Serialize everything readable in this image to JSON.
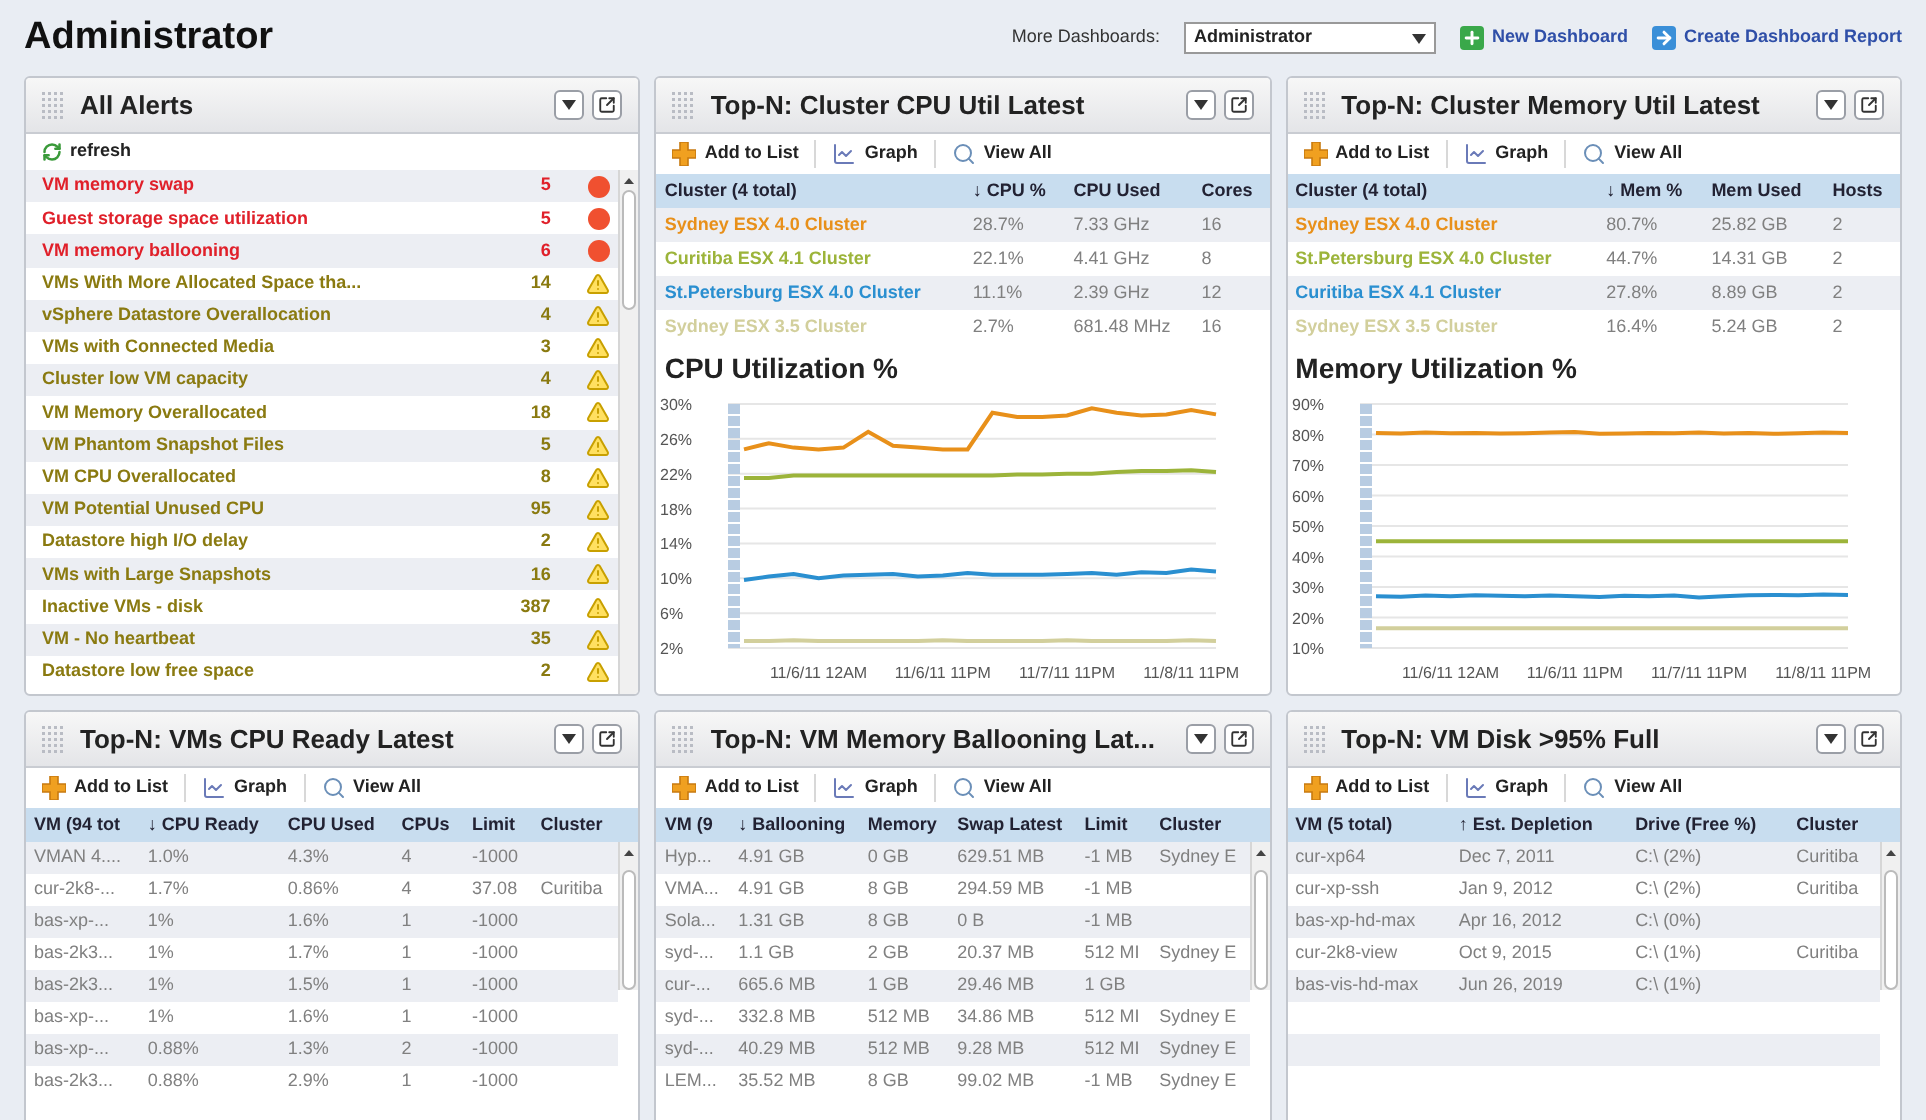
{
  "page_title": "Administrator",
  "header": {
    "dashboards_label": "More Dashboards:",
    "dashboard_select": "Administrator",
    "links": [
      {
        "label": "New Dashboard",
        "kind": "add"
      },
      {
        "label": "Create Dashboard Report",
        "kind": "report"
      }
    ]
  },
  "panels": [
    {
      "kind": "alerts",
      "title": "All Alerts",
      "refresh": "refresh",
      "alerts": [
        {
          "name": "VM memory swap",
          "count": "5",
          "kind": "critical"
        },
        {
          "name": "Guest storage space utilization",
          "count": "5",
          "kind": "critical"
        },
        {
          "name": "VM memory ballooning",
          "count": "6",
          "kind": "critical"
        },
        {
          "name": "VMs With More Allocated Space tha...",
          "count": "14",
          "kind": "warning"
        },
        {
          "name": "vSphere Datastore Overallocation",
          "count": "4",
          "kind": "warning"
        },
        {
          "name": "VMs with Connected Media",
          "count": "3",
          "kind": "warning"
        },
        {
          "name": "Cluster low VM capacity",
          "count": "4",
          "kind": "warning"
        },
        {
          "name": "VM Memory Overallocated",
          "count": "18",
          "kind": "warning"
        },
        {
          "name": "VM Phantom Snapshot Files",
          "count": "5",
          "kind": "warning"
        },
        {
          "name": "VM CPU Overallocated",
          "count": "8",
          "kind": "warning"
        },
        {
          "name": "VM Potential Unused CPU",
          "count": "95",
          "kind": "warning"
        },
        {
          "name": "Datastore high I/O delay",
          "count": "2",
          "kind": "warning"
        },
        {
          "name": "VMs with Large Snapshots",
          "count": "16",
          "kind": "warning"
        },
        {
          "name": "Inactive VMs - disk",
          "count": "387",
          "kind": "warning"
        },
        {
          "name": "VM - No heartbeat",
          "count": "35",
          "kind": "warning"
        },
        {
          "name": "Datastore low free space",
          "count": "2",
          "kind": "warning"
        }
      ]
    },
    {
      "kind": "table_chart",
      "title": "Top-N: Cluster CPU Util Latest",
      "toolbar": [
        "Add to List",
        "Graph",
        "View All"
      ],
      "columns": [
        "Cluster (4 total)",
        "↓ CPU %",
        "CPU Used",
        "Cores"
      ],
      "rows": [
        {
          "color": "#e8901a",
          "cells": [
            "Sydney ESX 4.0 Cluster",
            "28.7%",
            "7.33 GHz",
            "16"
          ]
        },
        {
          "color": "#9cb43a",
          "cells": [
            "Curitiba ESX 4.1 Cluster",
            "22.1%",
            "4.41 GHz",
            "8"
          ]
        },
        {
          "color": "#2a8fd0",
          "cells": [
            "St.Petersburg ESX 4.0 Cluster",
            "11.1%",
            "2.39 GHz",
            "12"
          ]
        },
        {
          "color": "#d2cf9c",
          "cells": [
            "Sydney ESX 3.5 Cluster",
            "2.7%",
            "681.48 MHz",
            "16"
          ]
        }
      ],
      "chart_title": "CPU Utilization %",
      "chart_data": {
        "type": "line",
        "categories": [
          null,
          null,
          null,
          "11/6/11 12AM",
          null,
          null,
          null,
          null,
          "11/6/11 11PM",
          null,
          null,
          null,
          null,
          "11/7/11 11PM",
          null,
          null,
          null,
          null,
          "11/8/11 11PM",
          null
        ],
        "grid": true,
        "ylim": [
          2,
          30
        ],
        "yticks": [
          {
            "value": 2,
            "label": "2%"
          },
          {
            "value": 6,
            "label": "6%"
          },
          {
            "value": 10,
            "label": "10%"
          },
          {
            "value": 14,
            "label": "14%"
          },
          {
            "value": 18,
            "label": "18%"
          },
          {
            "value": 22,
            "label": "22%"
          },
          {
            "value": 26,
            "label": "26%"
          },
          {
            "value": 30,
            "label": "30%"
          }
        ],
        "series": [
          {
            "color": "#e8901a",
            "values": [
              24.8,
              25.5,
              25,
              24.8,
              25,
              26.8,
              25.2,
              25,
              24.8,
              24.8,
              29,
              28.5,
              28.5,
              28.7,
              29.5,
              29,
              28.7,
              28.8,
              29.3,
              28.8
            ]
          },
          {
            "color": "#9cb43a",
            "values": [
              21.5,
              21.5,
              21.8,
              21.8,
              21.8,
              21.8,
              21.8,
              21.8,
              21.8,
              21.8,
              21.8,
              21.9,
              21.9,
              22,
              22,
              22.2,
              22.3,
              22.3,
              22.4,
              22.2
            ]
          },
          {
            "color": "#2a8fd0",
            "values": [
              9.8,
              10.2,
              10.5,
              10,
              10.3,
              10.4,
              10.5,
              10.2,
              10.3,
              10.6,
              10.4,
              10.4,
              10.4,
              10.5,
              10.6,
              10.4,
              10.7,
              10.6,
              11,
              10.8
            ]
          },
          {
            "color": "#d2cf9c",
            "values": [
              2.8,
              2.8,
              2.9,
              2.8,
              2.8,
              2.8,
              2.8,
              2.8,
              2.9,
              2.8,
              2.8,
              2.8,
              2.8,
              2.9,
              2.8,
              2.8,
              2.8,
              2.8,
              2.9,
              2.8
            ]
          }
        ]
      }
    },
    {
      "kind": "table_chart",
      "title": "Top-N: Cluster Memory Util Latest",
      "toolbar": [
        "Add to List",
        "Graph",
        "View All"
      ],
      "columns": [
        "Cluster (4 total)",
        "↓ Mem %",
        "Mem Used",
        "Hosts"
      ],
      "rows": [
        {
          "color": "#e8901a",
          "cells": [
            "Sydney ESX 4.0 Cluster",
            "80.7%",
            "25.82 GB",
            "2"
          ]
        },
        {
          "color": "#9cb43a",
          "cells": [
            "St.Petersburg ESX 4.0 Cluster",
            "44.7%",
            "14.31 GB",
            "2"
          ]
        },
        {
          "color": "#2a8fd0",
          "cells": [
            "Curitiba ESX 4.1 Cluster",
            "27.8%",
            "8.89 GB",
            "2"
          ]
        },
        {
          "color": "#d2cf9c",
          "cells": [
            "Sydney ESX 3.5 Cluster",
            "16.4%",
            "5.24 GB",
            "2"
          ]
        }
      ],
      "chart_title": "Memory Utilization %",
      "chart_data": {
        "type": "line",
        "categories": [
          null,
          null,
          null,
          "11/6/11 12AM",
          null,
          null,
          null,
          null,
          "11/6/11 11PM",
          null,
          null,
          null,
          null,
          "11/7/11 11PM",
          null,
          null,
          null,
          null,
          "11/8/11 11PM",
          null
        ],
        "grid": true,
        "ylim": [
          10,
          90
        ],
        "yticks": [
          {
            "value": 10,
            "label": "10%"
          },
          {
            "value": 20,
            "label": "20%"
          },
          {
            "value": 30,
            "label": "30%"
          },
          {
            "value": 40,
            "label": "40%"
          },
          {
            "value": 50,
            "label": "50%"
          },
          {
            "value": 60,
            "label": "60%"
          },
          {
            "value": 70,
            "label": "70%"
          },
          {
            "value": 80,
            "label": "80%"
          },
          {
            "value": 90,
            "label": "90%"
          }
        ],
        "series": [
          {
            "color": "#e8901a",
            "values": [
              80.5,
              80.3,
              80.6,
              80.4,
              80.5,
              80.3,
              80.4,
              80.6,
              80.8,
              80.2,
              80.3,
              80.5,
              80.4,
              80.6,
              80.3,
              80.5,
              80.2,
              80.4,
              80.6,
              80.5
            ]
          },
          {
            "color": "#9cb43a",
            "values": [
              45,
              45,
              45,
              45,
              45,
              45,
              45,
              45,
              45,
              45,
              45,
              45,
              45,
              45,
              45,
              45,
              45,
              45,
              45,
              45
            ]
          },
          {
            "color": "#2a8fd0",
            "values": [
              27,
              26.8,
              27.2,
              27,
              27.3,
              27.1,
              27,
              27.2,
              27,
              26.7,
              27.1,
              27,
              27.2,
              26.6,
              27,
              27.3,
              27.4,
              27.3,
              27.5,
              27.4
            ]
          },
          {
            "color": "#d2cf9c",
            "values": [
              16.5,
              16.5,
              16.5,
              16.5,
              16.5,
              16.5,
              16.5,
              16.5,
              16.5,
              16.5,
              16.5,
              16.5,
              16.5,
              16.5,
              16.5,
              16.5,
              16.5,
              16.5,
              16.5,
              16.5
            ]
          }
        ]
      }
    },
    {
      "kind": "table",
      "title": "Top-N: VMs CPU Ready Latest",
      "toolbar": [
        "Add to List",
        "Graph",
        "View All"
      ],
      "columns": [
        "VM (94 tot",
        "↓ CPU Ready",
        "CPU Used",
        "CPUs",
        "Limit",
        "Cluster"
      ],
      "rows": [
        [
          "VMAN 4....",
          "1.0%",
          "4.3%",
          "4",
          "-1000",
          ""
        ],
        [
          "cur-2k8-...",
          "1.7%",
          "0.86%",
          "4",
          "37.08",
          "Curitiba"
        ],
        [
          "bas-xp-...",
          "1%",
          "1.6%",
          "1",
          "-1000",
          ""
        ],
        [
          "bas-2k3...",
          "1%",
          "1.7%",
          "1",
          "-1000",
          ""
        ],
        [
          "bas-2k3...",
          "1%",
          "1.5%",
          "1",
          "-1000",
          ""
        ],
        [
          "bas-xp-...",
          "1%",
          "1.6%",
          "1",
          "-1000",
          ""
        ],
        [
          "bas-xp-...",
          "0.88%",
          "1.3%",
          "2",
          "-1000",
          ""
        ],
        [
          "bas-2k3...",
          "0.88%",
          "2.9%",
          "1",
          "-1000",
          ""
        ]
      ]
    },
    {
      "kind": "table",
      "title": "Top-N: VM Memory Ballooning Lat...",
      "toolbar": [
        "Add to List",
        "Graph",
        "View All"
      ],
      "columns": [
        "VM (9",
        "↓ Ballooning",
        "Memory",
        "Swap Latest",
        "Limit",
        "Cluster"
      ],
      "rows": [
        [
          "Hyp...",
          "4.91 GB",
          "0 GB",
          "629.51 MB",
          "-1 MB",
          "Sydney E"
        ],
        [
          "VMA...",
          "4.91 GB",
          "8 GB",
          "294.59 MB",
          "-1 MB",
          ""
        ],
        [
          "Sola...",
          "1.31 GB",
          "8 GB",
          "0 B",
          "-1 MB",
          ""
        ],
        [
          "syd-...",
          "1.1 GB",
          "2 GB",
          "20.37 MB",
          "512 MI",
          "Sydney E"
        ],
        [
          "cur-...",
          "665.6 MB",
          "1 GB",
          "29.46 MB",
          "1 GB",
          ""
        ],
        [
          "syd-...",
          "332.8 MB",
          "512 MB",
          "34.86 MB",
          "512 MI",
          "Sydney E"
        ],
        [
          "syd-...",
          "40.29 MB",
          "512 MB",
          "9.28 MB",
          "512 MI",
          "Sydney E"
        ],
        [
          "LEM...",
          "35.52 MB",
          "8 GB",
          "99.02 MB",
          "-1 MB",
          "Sydney E"
        ]
      ]
    },
    {
      "kind": "table",
      "title": "Top-N: VM Disk >95% Full",
      "toolbar": [
        "Add to List",
        "Graph",
        "View All"
      ],
      "columns": [
        "VM (5 total)",
        "↑ Est. Depletion",
        "Drive (Free %)",
        "Cluster"
      ],
      "rows": [
        [
          "cur-xp64",
          "Dec 7, 2011",
          "C:\\ (2%)",
          "Curitiba"
        ],
        [
          "cur-xp-ssh",
          "Jan 9, 2012",
          "C:\\ (2%)",
          "Curitiba"
        ],
        [
          "bas-xp-hd-max",
          "Apr 16, 2012",
          "C:\\ (0%)",
          ""
        ],
        [
          "cur-2k8-view",
          "Oct 9, 2015",
          "C:\\ (1%)",
          "Curitiba"
        ],
        [
          "bas-vis-hd-max",
          "Jun 26, 2019",
          "C:\\ (1%)",
          ""
        ],
        [
          "",
          "",
          "",
          ""
        ],
        [
          "",
          "",
          "",
          ""
        ],
        [
          "",
          "",
          "",
          ""
        ]
      ]
    }
  ]
}
